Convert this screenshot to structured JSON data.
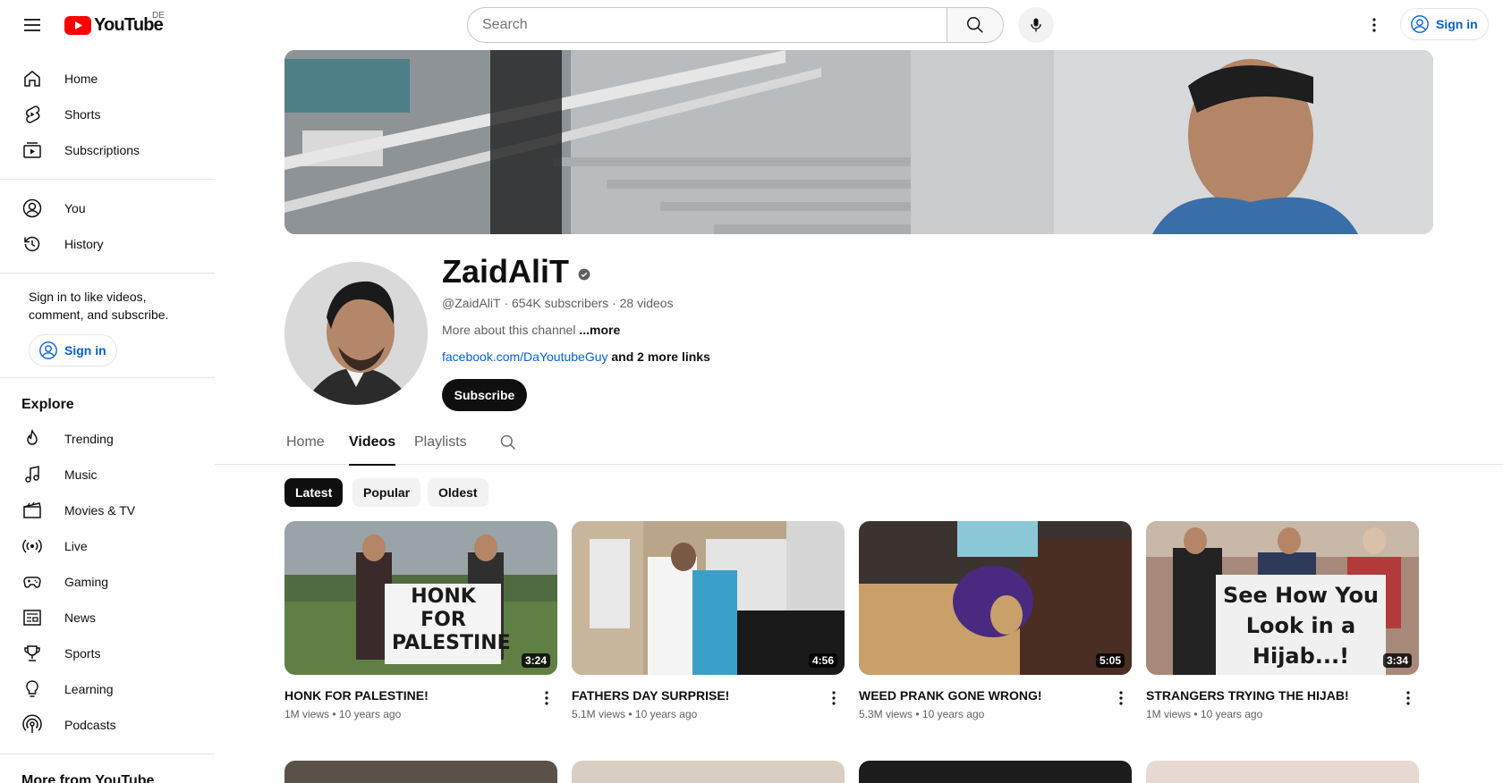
{
  "header": {
    "logo_text": "YouTube",
    "country_code": "DE",
    "search_placeholder": "Search",
    "sign_in_label": "Sign in"
  },
  "sidebar": {
    "primary": [
      {
        "label": "Home",
        "icon": "home-icon"
      },
      {
        "label": "Shorts",
        "icon": "shorts-icon"
      },
      {
        "label": "Subscriptions",
        "icon": "subscriptions-icon"
      }
    ],
    "you": [
      {
        "label": "You",
        "icon": "account-icon"
      },
      {
        "label": "History",
        "icon": "history-icon"
      }
    ],
    "signin_prompt": "Sign in to like videos, comment, and subscribe.",
    "signin_label": "Sign in",
    "explore_heading": "Explore",
    "explore": [
      {
        "label": "Trending",
        "icon": "trending-icon"
      },
      {
        "label": "Music",
        "icon": "music-icon"
      },
      {
        "label": "Movies & TV",
        "icon": "movies-icon"
      },
      {
        "label": "Live",
        "icon": "live-icon"
      },
      {
        "label": "Gaming",
        "icon": "gaming-icon"
      },
      {
        "label": "News",
        "icon": "news-icon"
      },
      {
        "label": "Sports",
        "icon": "sports-icon"
      },
      {
        "label": "Learning",
        "icon": "learning-icon"
      },
      {
        "label": "Podcasts",
        "icon": "podcasts-icon"
      }
    ],
    "more_heading": "More from YouTube"
  },
  "channel": {
    "name": "ZaidAliT",
    "handle": "@ZaidAliT",
    "subscribers": "654K subscribers",
    "videos_count": "28 videos",
    "separator": " · ",
    "about": "More about this channel",
    "about_more": "...more",
    "link": "facebook.com/DaYoutubeGuy",
    "more_links": "and 2 more links",
    "subscribe_label": "Subscribe"
  },
  "tabs": [
    {
      "label": "Home",
      "active": false
    },
    {
      "label": "Videos",
      "active": true
    },
    {
      "label": "Playlists",
      "active": false
    }
  ],
  "filters": [
    {
      "label": "Latest",
      "active": true
    },
    {
      "label": "Popular",
      "active": false
    },
    {
      "label": "Oldest",
      "active": false
    }
  ],
  "videos": [
    {
      "title": "HONK FOR PALESTINE!",
      "views": "1M views",
      "age": "10 years ago",
      "duration": "3:24",
      "sign_text": "HONK FOR PALESTINE"
    },
    {
      "title": "FATHERS DAY SURPRISE!",
      "views": "5.1M views",
      "age": "10 years ago",
      "duration": "4:56"
    },
    {
      "title": "WEED PRANK GONE WRONG!",
      "views": "5.3M views",
      "age": "10 years ago",
      "duration": "5:05"
    },
    {
      "title": "STRANGERS TRYING THE HIJAB!",
      "views": "1M views",
      "age": "10 years ago",
      "duration": "3:34",
      "sign_text": "See How You Look in a Hijab...!"
    }
  ],
  "meta_dot": " • ",
  "colors": {
    "brand_red": "#ff0000",
    "link_blue": "#065fd4",
    "text": "#0f0f0f",
    "secondary": "#606060"
  }
}
